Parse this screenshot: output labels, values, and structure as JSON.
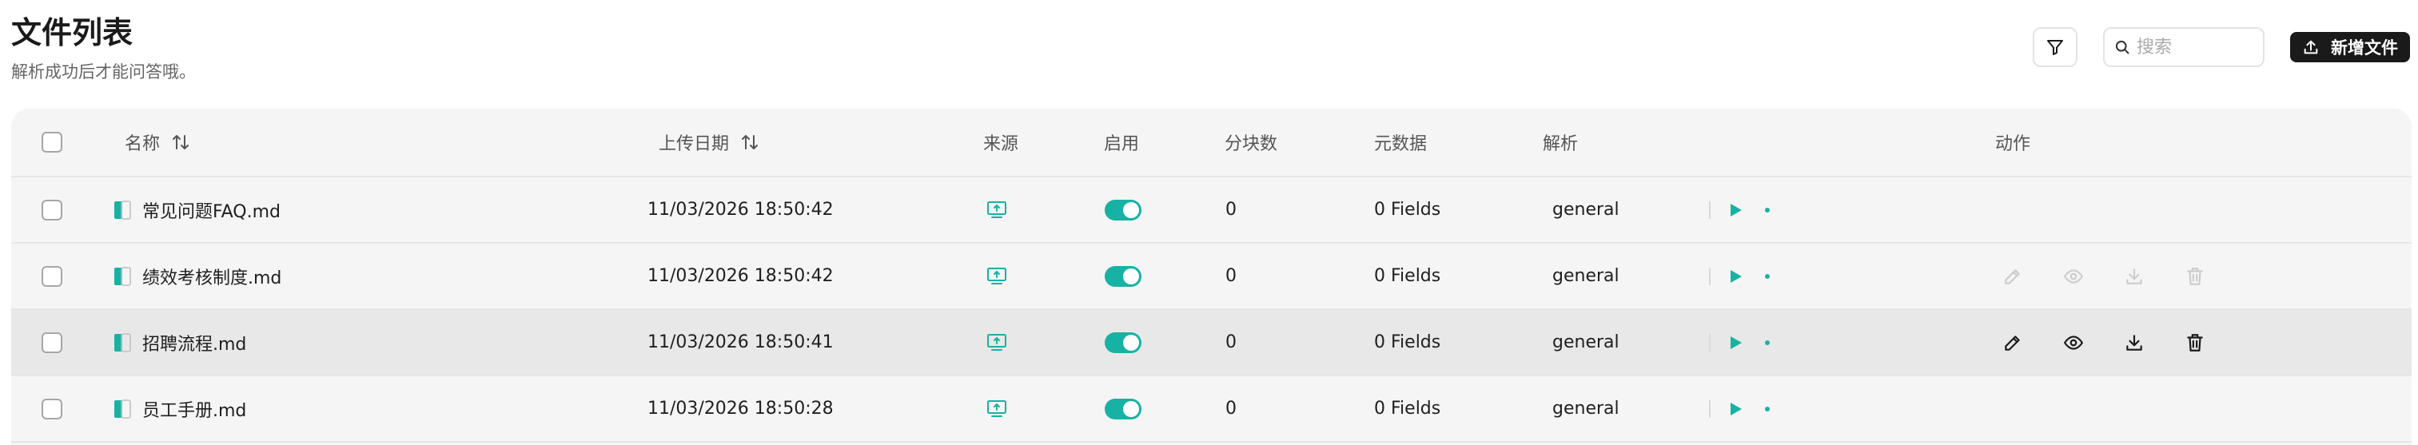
{
  "header": {
    "title": "文件列表",
    "subtitle": "解析成功后才能问答哦。"
  },
  "toolbar": {
    "search_placeholder": "搜索",
    "add_label": "新增文件"
  },
  "columns": {
    "name": "名称",
    "upload_date": "上传日期",
    "source": "来源",
    "enabled": "启用",
    "chunks": "分块数",
    "metadata": "元数据",
    "parse": "解析",
    "actions": "动作"
  },
  "rows": [
    {
      "name": "常见问题FAQ.md",
      "date": "11/03/2026 18:50:42",
      "chunks": "0",
      "metadata": "0 Fields",
      "parser": "general",
      "enabled": true
    },
    {
      "name": "绩效考核制度.md",
      "date": "11/03/2026 18:50:42",
      "chunks": "0",
      "metadata": "0 Fields",
      "parser": "general",
      "enabled": true
    },
    {
      "name": "招聘流程.md",
      "date": "11/03/2026 18:50:41",
      "chunks": "0",
      "metadata": "0 Fields",
      "parser": "general",
      "enabled": true
    },
    {
      "name": "员工手册.md",
      "date": "11/03/2026 18:50:28",
      "chunks": "0",
      "metadata": "0 Fields",
      "parser": "general",
      "enabled": true
    }
  ],
  "colors": {
    "accent": "#17b2a3",
    "primary_button": "#1a1a1a"
  }
}
